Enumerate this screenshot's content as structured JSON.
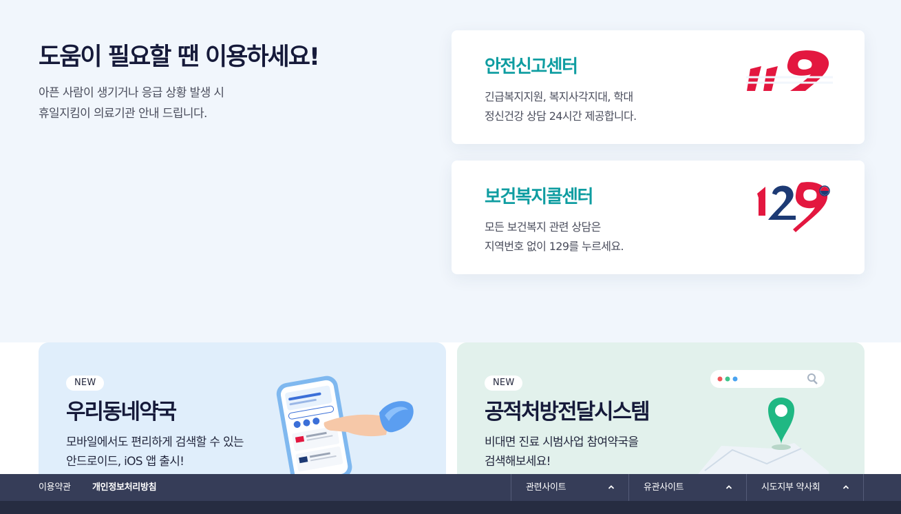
{
  "help": {
    "title": "도움이 필요할 땐 이용하세요!",
    "desc_lines": [
      "아픈 사람이 생기거나 응급 상황 발생 시",
      "휴일지킴이 의료기관 안내 드립니다."
    ]
  },
  "cards": [
    {
      "title": "안전신고센터",
      "desc_lines": [
        "긴급복지지원, 복지사각지대, 학대",
        "정신건강 상담 24시간 제공합니다."
      ],
      "logo": "119-logo",
      "logo_text": "119"
    },
    {
      "title": "보건복지콜센터",
      "desc_lines": [
        "모든 보건복지 관련 상담은",
        "지역번호 없이 129를 누르세요."
      ],
      "logo": "129-logo",
      "logo_text": "129"
    }
  ],
  "promos": [
    {
      "badge": "NEW",
      "title": "우리동네약국",
      "desc_lines": [
        "모바일에서도 편리하게 검색할 수 있는",
        "안드로이드, iOS 앱 출시!"
      ],
      "illustration": "phone-hand-illustration"
    },
    {
      "badge": "NEW",
      "title": "공적처방전달시스템",
      "desc_lines": [
        "비대면 진료 시범사업 참여약국을",
        "검색해보세요!"
      ],
      "illustration": "map-pin-illustration"
    }
  ],
  "footer": {
    "links": [
      "이용약관",
      "개인정보처리방침"
    ],
    "dropdowns": [
      "관련사이트",
      "유관사이트",
      "시도지부 약사회"
    ]
  },
  "colors": {
    "accent_teal": "#0f9da1",
    "brand_red": "#e3173f",
    "brand_navy": "#1d3a74",
    "footer_bg": "#363d58"
  }
}
